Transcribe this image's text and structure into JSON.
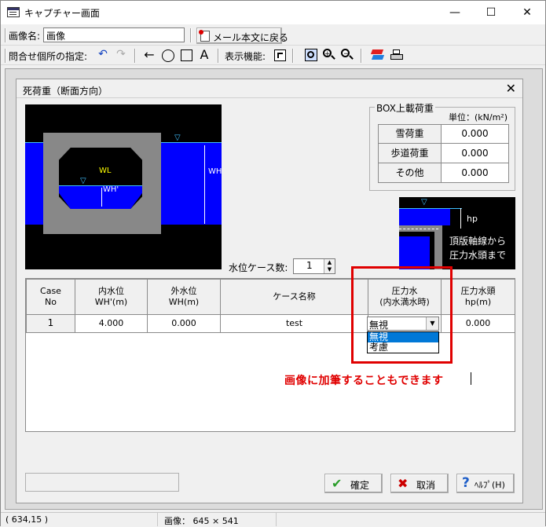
{
  "window": {
    "title": "キャプチャー画面",
    "minimize": "—",
    "maximize": "☐",
    "close": "✕"
  },
  "row1": {
    "image_name_label": "画像名:",
    "image_name_value": "画像",
    "back_button": "メール本文に戻る"
  },
  "row2": {
    "inquiry_label": "問合せ個所の指定:",
    "text_tool": "A",
    "display_label": "表示機能:"
  },
  "dialog": {
    "title": "死荷重（断面方向）",
    "diagram": {
      "wl": "WL",
      "wh_inner": "WH'",
      "wh": "WH"
    },
    "box_load": {
      "legend": "BOX上載荷重",
      "unit": "単位：(kN/m²)",
      "rows": [
        {
          "label": "雪荷重",
          "value": "0.000"
        },
        {
          "label": "歩道荷重",
          "value": "0.000"
        },
        {
          "label": "その他",
          "value": "0.000"
        }
      ]
    },
    "hp_diagram": {
      "hp": "hp",
      "note_line1": "頂版軸線から",
      "note_line2": "圧力水頭まで"
    },
    "water_case_label": "水位ケース数:",
    "water_case_value": "1",
    "table": {
      "headers": [
        "Case\nNo",
        "内水位\nWH'(m)",
        "外水位\nWH(m)",
        "ケース名称",
        "圧力水\n(内水満水時)",
        "圧力水頭\nhp(m)"
      ],
      "rows": [
        {
          "case": "1",
          "inner": "4.000",
          "outer": "0.000",
          "name": "test",
          "pressure": "無視",
          "hp": "0.000"
        }
      ],
      "dropdown_options": [
        "無視",
        "考慮"
      ]
    },
    "annotation": "画像に加筆することもできます",
    "buttons": {
      "ok": "確定",
      "cancel": "取消",
      "help": "ﾍﾙﾌﾟ(H)"
    }
  },
  "status": {
    "coords": "( 634,15 )",
    "image_size": "画像： 645 × 541"
  },
  "colors": {
    "water": "#0000ff",
    "concrete": "#888888",
    "annotation_red": "#e00000",
    "selection": "#0078d7"
  }
}
